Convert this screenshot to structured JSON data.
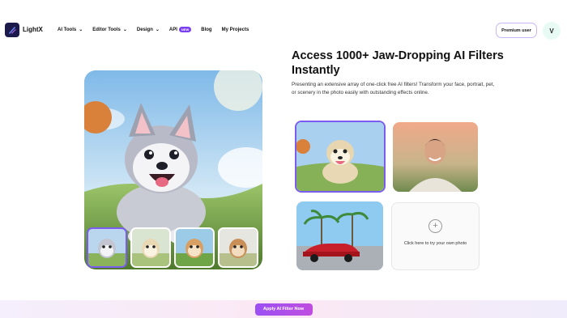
{
  "brand": {
    "name": "LightX"
  },
  "nav": {
    "items": [
      {
        "label": "AI Tools",
        "has_dropdown": true
      },
      {
        "label": "Editor Tools",
        "has_dropdown": true
      },
      {
        "label": "Design",
        "has_dropdown": true
      },
      {
        "label": "API",
        "badge": "NEW"
      },
      {
        "label": "Blog"
      },
      {
        "label": "My Projects"
      }
    ],
    "premium_label": "Premium user",
    "avatar_initial": "V"
  },
  "hero": {
    "headline": "Access 1000+ Jaw-Dropping AI Filters Instantly",
    "description": "Presenting an extensive array of one-click free AI filters! Transform your face, portrait, pet, or scenery in the photo easily with outstanding effects online."
  },
  "samples": {
    "upload_label": "Click here to try your own photo",
    "plus_glyph": "+"
  },
  "cta": {
    "apply_label": "Apply AI Filter Now"
  },
  "colors": {
    "accent": "#7b5cf0",
    "badge": "#7b3ff2",
    "cta_start": "#9b4ff3",
    "cta_end": "#c04de0"
  }
}
